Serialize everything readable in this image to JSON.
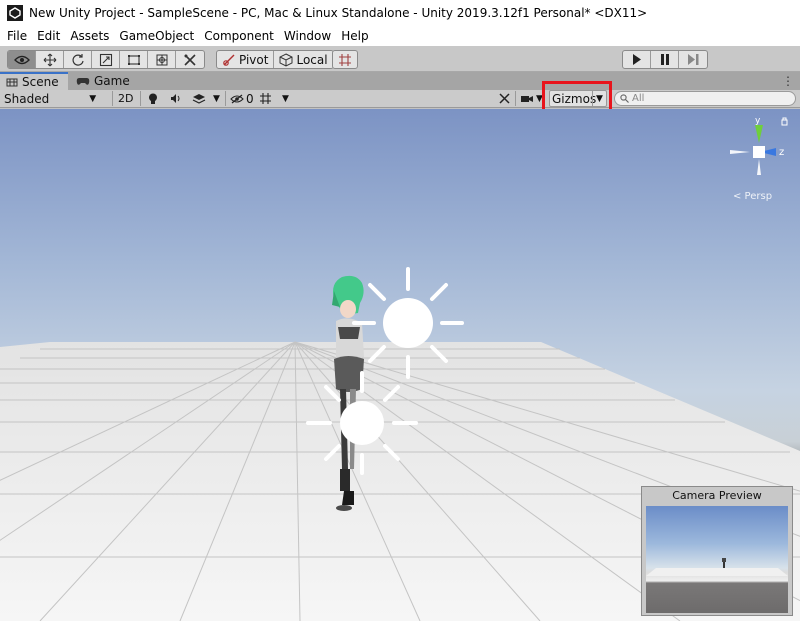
{
  "window": {
    "title": "New Unity Project - SampleScene - PC, Mac & Linux Standalone - Unity 2019.3.12f1 Personal* <DX11>"
  },
  "menu": {
    "items": [
      "File",
      "Edit",
      "Assets",
      "GameObject",
      "Component",
      "Window",
      "Help"
    ]
  },
  "toolbar": {
    "tools": [
      {
        "name": "view-tool",
        "icon": "eye-icon",
        "glyph": "👁"
      },
      {
        "name": "move-tool",
        "icon": "move-icon",
        "glyph": "✥"
      },
      {
        "name": "rotate-tool",
        "icon": "rotate-icon",
        "glyph": "⟳"
      },
      {
        "name": "scale-tool",
        "icon": "scale-icon",
        "glyph": "⤡"
      },
      {
        "name": "rect-tool",
        "icon": "rect-icon",
        "glyph": "⬚"
      },
      {
        "name": "transform-tool",
        "icon": "transform-icon",
        "glyph": "⊕"
      },
      {
        "name": "custom-tool",
        "icon": "custom-tool-icon",
        "glyph": "✂"
      }
    ],
    "pivot_label": "Pivot",
    "local_label": "Local",
    "play_glyph": "▶",
    "pause_glyph": "❚❚",
    "step_glyph": "▶❙"
  },
  "tabs": [
    {
      "label": "Scene",
      "icon": "scene-icon",
      "glyph": "⊞"
    },
    {
      "label": "Game",
      "icon": "gamepad-icon",
      "glyph": "🎮"
    }
  ],
  "tabs_menu_glyph": "⋮",
  "scene_toolbar": {
    "shading_mode": "Shaded",
    "mode_2d": "2D",
    "hidden_count": "0",
    "gizmos_label": "Gizmos",
    "search_placeholder": "All"
  },
  "viewport": {
    "persp_label": "< Persp",
    "axis_y": "y",
    "axis_z": "z"
  },
  "camera_preview": {
    "title": "Camera Preview"
  },
  "colors": {
    "highlight": "#e8141c",
    "axis_y": "#6fcf3c",
    "axis_z": "#3a78e0",
    "ground": "#eeeeee",
    "horizon": "#6e6d6d"
  }
}
